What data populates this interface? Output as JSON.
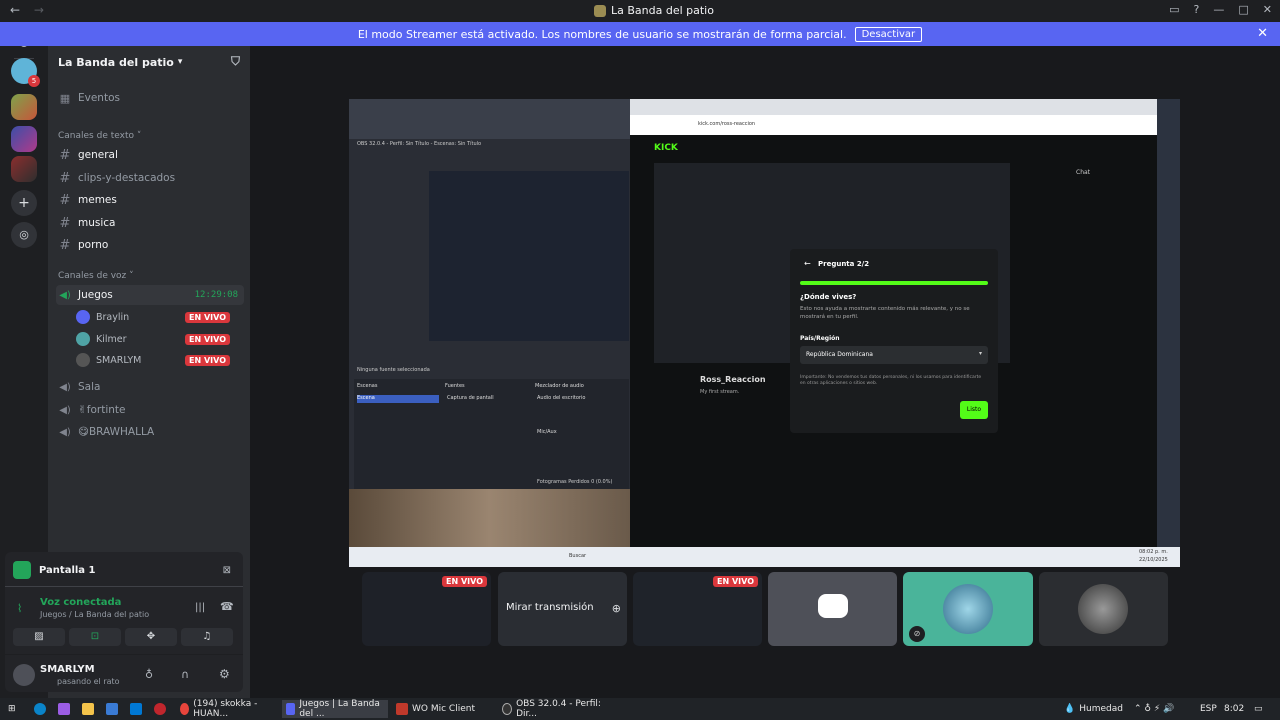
{
  "window": {
    "title": "La Banda del patio"
  },
  "banner": {
    "text": "El modo Streamer está activado. Los nombres de usuario se mostrarán de forma parcial.",
    "button": "Desactivar"
  },
  "server": {
    "name": "La Banda del patio"
  },
  "sidebar": {
    "events": "Eventos",
    "text_category": "Canales de texto",
    "text_channels": [
      "general",
      "clips-y-destacados",
      "memes",
      "musica",
      "porno"
    ],
    "voice_category": "Canales de voz",
    "voice_channels": [
      {
        "name": "Juegos",
        "timer": "12:29:08"
      },
      {
        "name": "Sala"
      },
      {
        "name": "✌fortinte"
      },
      {
        "name": "😋BRAWHALLA"
      }
    ],
    "voice_users": [
      {
        "name": "Braylin",
        "badge": "EN VIVO"
      },
      {
        "name": "Kilmer",
        "badge": "EN VIVO"
      },
      {
        "name": "SMARLYM",
        "badge": "EN VIVO"
      }
    ]
  },
  "panel": {
    "screen": "Pantalla 1",
    "voice_status": "Voz conectada",
    "voice_location": "Juegos / La Banda del patio",
    "user": "SMARLYM",
    "user_status": "pasando el rato"
  },
  "stream": {
    "modal_title": "Pregunta 2/2",
    "modal_heading": "¿Dónde vives?",
    "modal_desc": "Esto nos ayuda a mostrarte contenido más relevante, y no se mostrará en tu perfil.",
    "modal_label": "País/Región",
    "modal_value": "República Dominicana",
    "modal_note": "Importante: No vendemos tus datos personales, ni los usamos para identificarte en otras aplicaciones o sitios web.",
    "modal_btn": "Listo",
    "url": "kick.com/ross-reaccion",
    "channel": "Ross_Reaccion",
    "channel_sub": "My first stream.",
    "chat": "Chat",
    "obs_title": "OBS 32.0.4 - Perfil: Sin Título - Escenas: Sin Título",
    "obs_scenes": "Escenas",
    "obs_sources": "Fuentes",
    "obs_mixer": "Mezclador de audio",
    "obs_scene_item": "Escena",
    "obs_source_item": "Captura de pantall",
    "obs_audio1": "Audio del escritorio",
    "obs_audio2": "Mic/Aux",
    "obs_no_source": "Ninguna fuente seleccionada",
    "obs_frames": "Fotogramas Perdidos 0 (0.0%)",
    "tray_time": "08:02 p. m.",
    "tray_date": "22/10/2025",
    "search": "Buscar"
  },
  "thumbs": {
    "live": "EN VIVO",
    "watch": "Mirar transmisión"
  },
  "taskbar": {
    "items": [
      "(194) skokka - HUAN...",
      "Juegos | La Banda del ...",
      "WO Mic Client",
      "OBS 32.0.4 - Perfil: Dir..."
    ],
    "weather": "Humedad",
    "lang": "ESP",
    "time": "8:02"
  }
}
